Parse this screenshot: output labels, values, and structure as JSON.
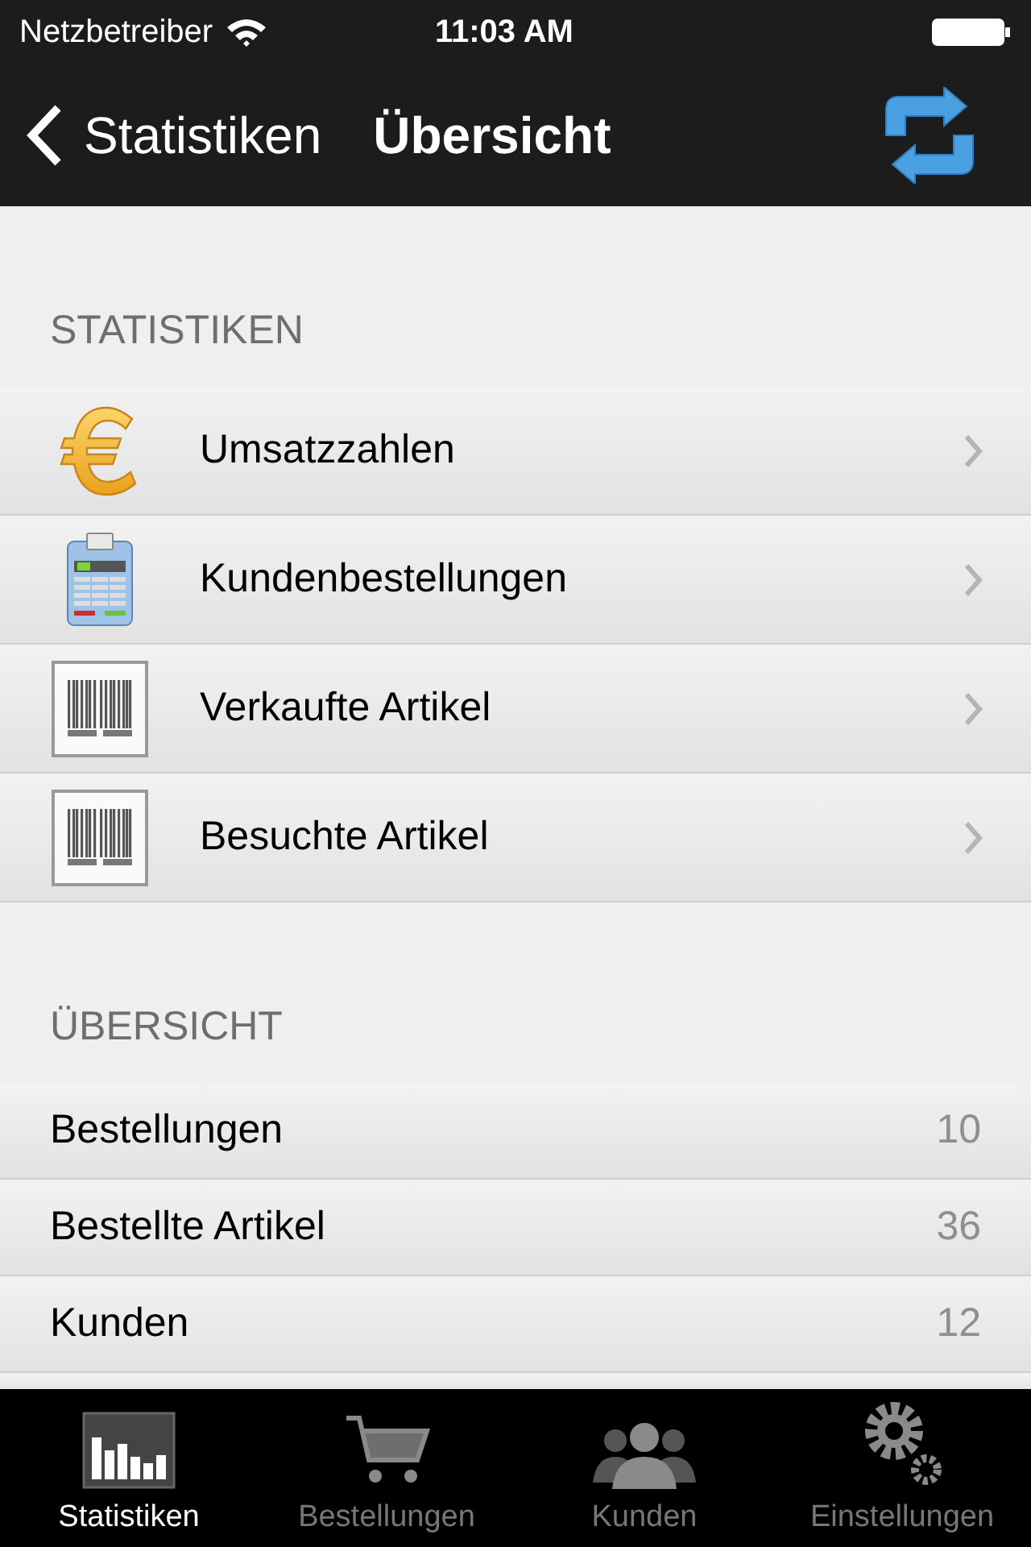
{
  "status_bar": {
    "carrier": "Netzbetreiber",
    "time": "11:03 AM"
  },
  "nav_bar": {
    "back_label": "Statistiken",
    "title": "Übersicht"
  },
  "statistics_section": {
    "header": "STATISTIKEN",
    "items": [
      {
        "label": "Umsatzzahlen",
        "kind": "euro"
      },
      {
        "label": "Kundenbestellungen",
        "kind": "calculator"
      },
      {
        "label": "Verkaufte Artikel",
        "kind": "barcode"
      },
      {
        "label": "Besuchte Artikel",
        "kind": "barcode"
      }
    ]
  },
  "overview_section": {
    "header": "ÜBERSICHT",
    "rows": [
      {
        "label": "Bestellungen",
        "value": "10"
      },
      {
        "label": "Bestellte Artikel",
        "value": "36"
      },
      {
        "label": "Kunden",
        "value": "12"
      }
    ]
  },
  "tab_bar": [
    {
      "label": "Statistiken",
      "kind": "chart",
      "selected": true
    },
    {
      "label": "Bestellungen",
      "kind": "cart",
      "selected": false
    },
    {
      "label": "Kunden",
      "kind": "people",
      "selected": false
    },
    {
      "label": "Einstellungen",
      "kind": "gears",
      "selected": false
    }
  ]
}
